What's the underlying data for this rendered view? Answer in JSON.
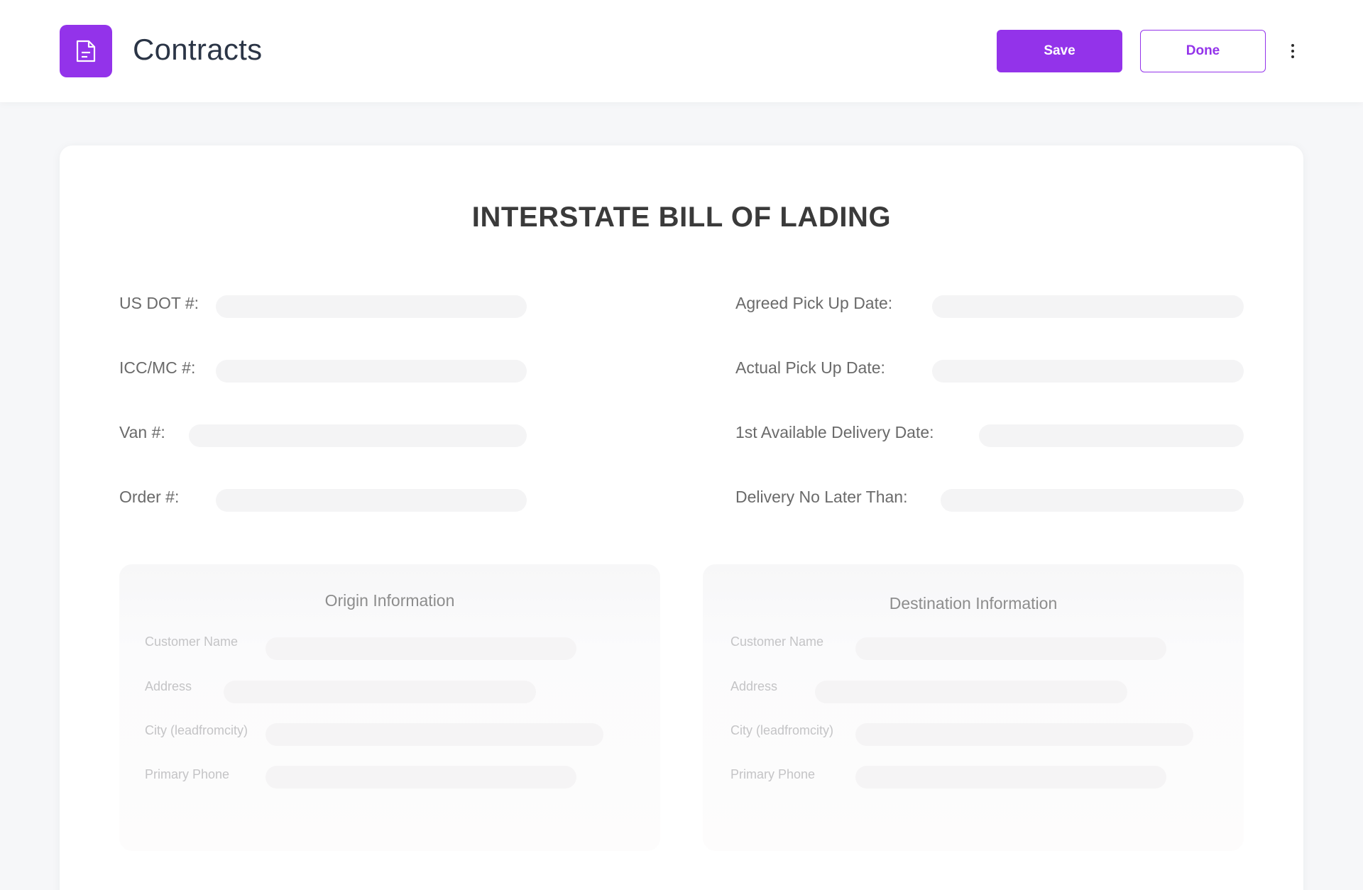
{
  "header": {
    "app_title": "Contracts",
    "app_icon": "document-icon",
    "save_label": "Save",
    "done_label": "Done",
    "more_icon": "more-vertical-icon",
    "accent_color": "#9333ea"
  },
  "document": {
    "title": "INTERSTATE BILL OF LADING",
    "left_fields": [
      {
        "label": "US DOT #:",
        "value": ""
      },
      {
        "label": "ICC/MC #:",
        "value": ""
      },
      {
        "label": "Van #:",
        "value": ""
      },
      {
        "label": "Order #:",
        "value": ""
      }
    ],
    "right_fields": [
      {
        "label": "Agreed Pick Up Date:",
        "value": ""
      },
      {
        "label": "Actual Pick Up Date:",
        "value": ""
      },
      {
        "label": "1st Available Delivery Date:",
        "value": ""
      },
      {
        "label": "Delivery No Later Than:",
        "value": ""
      }
    ]
  },
  "origin": {
    "title": "Origin Information",
    "fields": [
      {
        "label": "Customer Name",
        "value": ""
      },
      {
        "label": "Address",
        "value": ""
      },
      {
        "label": "City (leadfromcity)",
        "value": ""
      },
      {
        "label": "Primary Phone",
        "value": ""
      }
    ]
  },
  "destination": {
    "title": "Destination Information",
    "fields": [
      {
        "label": "Customer Name",
        "value": ""
      },
      {
        "label": "Address",
        "value": ""
      },
      {
        "label": "City (leadfromcity)",
        "value": ""
      },
      {
        "label": "Primary Phone",
        "value": ""
      }
    ]
  }
}
